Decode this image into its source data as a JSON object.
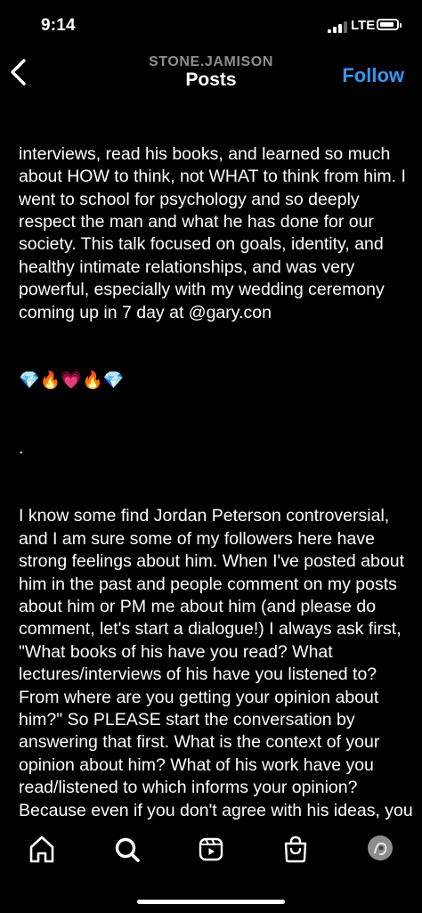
{
  "status_bar": {
    "time": "9:14",
    "network": "LTE",
    "battery_level": 0.75
  },
  "header": {
    "username": "STONE.JAMISON",
    "title": "Posts",
    "follow_label": "Follow"
  },
  "caption": {
    "paragraph1": "interviews, read his books, and learned so much about HOW to think, not WHAT to think from him. I went to school for psychology and so deeply respect the man and what he has done for our society. This talk focused on goals, identity, and healthy intimate relationships, and was very powerful, especially with my wedding ceremony coming up in 7 day at @gary.con",
    "emojis": "💎🔥💗🔥💎",
    "separator": ".",
    "paragraph2": "I know some find Jordan Peterson controversial, and I am sure some of my followers here have strong feelings about him. When I've posted about him in the past and people comment on my posts about him or PM me about him (and please do comment, let's start a dialogue!) I always ask first, \"What books of his have you read? What lectures/interviews of his have you listened to? From where are you getting your opinion about him?\" So PLEASE start the conversation by answering that first. What is the context of your opinion about him? What of his work have you read/listened to which informs your opinion? Because even if you don't agree with his ideas, you need to have a context of understanding of him and his work before we can start a dialogue about that work. So, please start from that question, and let's all learn, grow, and connect! Again:"
  },
  "nav": {
    "items": [
      {
        "icon": "home-icon"
      },
      {
        "icon": "search-icon"
      },
      {
        "icon": "reels-icon"
      },
      {
        "icon": "shop-icon"
      },
      {
        "icon": "profile-avatar"
      }
    ]
  },
  "colors": {
    "background": "#000000",
    "follow": "#3797f0",
    "username": "#8e8e8e"
  }
}
